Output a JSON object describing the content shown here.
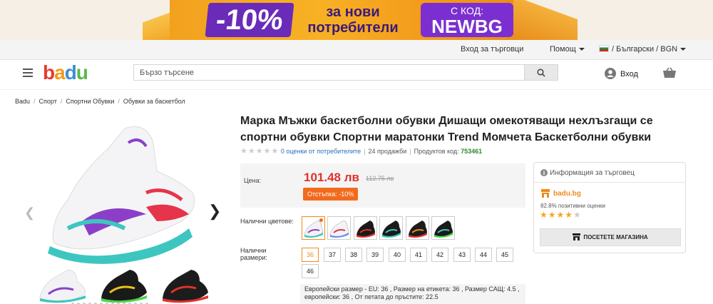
{
  "banner": {
    "percent": "-10%",
    "text_line1": "за нови",
    "text_line2": "потребители",
    "code_label": "С КОД:",
    "code": "NEWBG"
  },
  "topbar": {
    "seller_login": "Вход за търговци",
    "help": "Помощ",
    "locale": "/ Български / BGN"
  },
  "header": {
    "logo": {
      "b": "b",
      "a": "a",
      "d": "d",
      "u": "u"
    },
    "search_placeholder": "Бързо търсене",
    "login": "Вход"
  },
  "breadcrumb": [
    "Badu",
    "Спорт",
    "Спортни Обувки",
    "Обувки за баскетбол"
  ],
  "product": {
    "title": "Марка Мъжки баскетболни обувки Дишащи омекотяващи нехлъзгащи се спортни обувки Спортни маратонки Trend Момчета Баскетболни обувки",
    "reviews": "0 оценки от потребителите",
    "sales": "24 продажби",
    "code_label": "Продуктов код:",
    "code": "753461",
    "price_label": "Цена:",
    "price": "101.48 лв",
    "old_price": "112.75 лв",
    "discount": "Отстъпка: -10%",
    "colors_label": "Налични цветове:",
    "sizes_label": "Налични размери:",
    "sizes": [
      "36",
      "37",
      "38",
      "39",
      "40",
      "41",
      "42",
      "43",
      "44",
      "45",
      "46"
    ],
    "selected_size": "36",
    "size_note_line1": "Европейски размер - EU: 36 ,  Размер на етикета: 36 ,  Размер САЩ: 4.5 ,",
    "size_note_line2": "европейски: 36 ,  От петата до пръстите: 22.5"
  },
  "seller": {
    "heading": "Информация за търговец",
    "name": "badu.bg",
    "rating_text": "82.8% позитивни оценки",
    "rating": 4,
    "visit": "ПОСЕТЕТЕ МАГАЗИНА"
  },
  "colors": {
    "accent": "#f08a1c",
    "price": "#e0312c",
    "discount_bg": "#f26b1d",
    "code": "#2b8a2b",
    "link": "#2a6fb8"
  }
}
